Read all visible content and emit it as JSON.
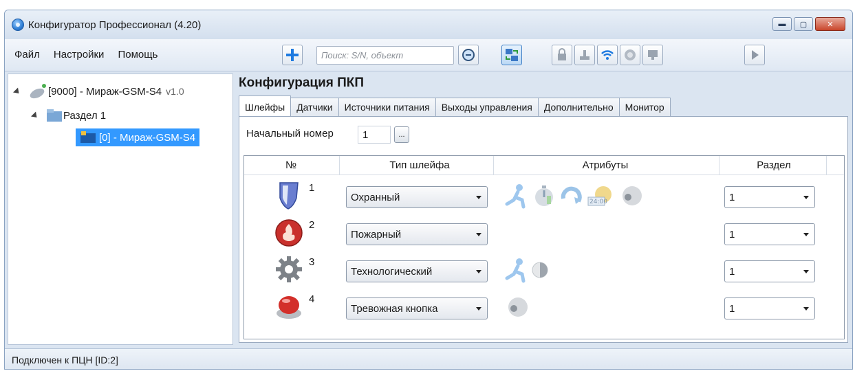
{
  "window": {
    "title": "Конфигуратор Профессионал (4.20)"
  },
  "menu": [
    "Файл",
    "Настройки",
    "Помощь"
  ],
  "toolbar": {
    "search_placeholder": "Поиск: S/N, объект"
  },
  "tree": {
    "root": {
      "label": "[9000] - Мираж-GSM-S4",
      "version": "v1.0"
    },
    "section": {
      "label": "Раздел 1"
    },
    "device": {
      "label": "[0] - Мираж-GSM-S4"
    }
  },
  "config": {
    "title": "Конфигурация ПКП",
    "tabs": [
      "Шлейфы",
      "Датчики",
      "Источники питания",
      "Выходы управления",
      "Дополнительно",
      "Монитор"
    ],
    "start_label": "Начальный номер",
    "start_value": "1",
    "dots": "...",
    "columns": [
      "№",
      "Тип шлейфа",
      "Атрибуты",
      "Раздел"
    ],
    "rows": [
      {
        "num": "1",
        "type": "Охранный",
        "section": "1",
        "icon": "shield-icon"
      },
      {
        "num": "2",
        "type": "Пожарный",
        "section": "1",
        "icon": "fire-icon"
      },
      {
        "num": "3",
        "type": "Технологический",
        "section": "1",
        "icon": "gear-icon"
      },
      {
        "num": "4",
        "type": "Тревожная кнопка",
        "section": "1",
        "icon": "panic-button-icon"
      }
    ]
  },
  "status": {
    "text": "Подключен к ПЦН [ID:2]"
  }
}
